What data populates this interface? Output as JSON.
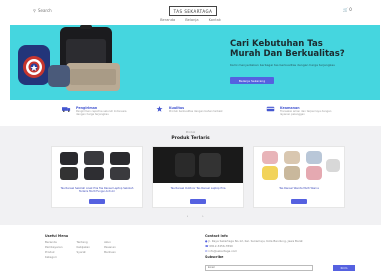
{
  "header": {
    "search_label": "Search",
    "logo_text": "TAS SEKARTAGA",
    "cart_label": "0"
  },
  "nav": {
    "items": [
      "Beranda",
      "Belanja",
      "Kontak"
    ]
  },
  "hero": {
    "title": "Cari Kebutuhan Tas Murah Dan Berkualitas?",
    "subtitle": "Kami menyediakan berbagai tas berkualitas dengan harga terjangkau",
    "button_label": "Belanja Sekarang",
    "bg_color": "#45d6df"
  },
  "features": [
    {
      "title": "Pengiriman",
      "desc": "Pengiriman cepat ke seluruh Indonesia dengan harga terjangkau"
    },
    {
      "title": "Kualitas",
      "desc": "Produk berkualitas dengan bahan terbaik"
    },
    {
      "title": "Keamanan",
      "desc": "Transaksi aman dan terpercaya dengan layanan pelanggan"
    }
  ],
  "products_section": {
    "kicker": "Produk",
    "title": "Produk Terlaris",
    "items": [
      {
        "name": "Tas Ransel Sekolah Anak Pria Tas Ransel Laptop Sekolah Terlaris Multi Fungsi Anti Air",
        "button_label": "Beli"
      },
      {
        "name": "Tas Ransel Outdoor Tas Ransel Laptop Pria",
        "button_label": "Beli"
      },
      {
        "name": "Tas Ransel Wanita Multi Warna",
        "button_label": "Beli"
      }
    ],
    "pagination": [
      "‹",
      "›"
    ]
  },
  "footer": {
    "menu_title": "Useful Menu",
    "menu_links": [
      [
        "Beranda",
        "Pembayaran",
        "Produk",
        "Kategori"
      ],
      [
        "Tentang",
        "Kebijakan",
        "Syarat"
      ],
      [
        "Akun",
        "Pesanan",
        "Bantuan"
      ]
    ],
    "contact_title": "Contact Info",
    "contact_address": "Jl. Raya Sekartaga No.12, Kel. Sukamaju, Kota Bandung, Jawa Barat",
    "contact_phone": "0812-3456-7890",
    "contact_email": "info@sekartaga.com",
    "subscribe_title": "Subscribe",
    "subscribe_placeholder": "Email",
    "subscribe_button": "Kirim"
  },
  "colors": {
    "accent": "#5561e0",
    "hero": "#45d6df",
    "section_bg": "#f1f1f3"
  }
}
